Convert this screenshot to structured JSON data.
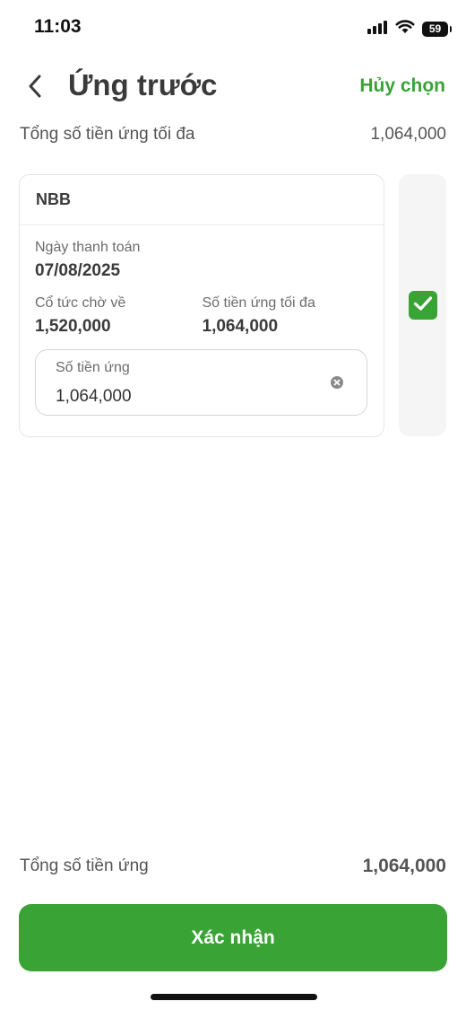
{
  "status_bar": {
    "time": "11:03",
    "battery": "59"
  },
  "header": {
    "title": "Ứng trước",
    "cancel_label": "Hủy chọn"
  },
  "summary": {
    "max_total_label": "Tổng số tiền ứng tối đa",
    "max_total_value": "1,064,000"
  },
  "card": {
    "symbol": "NBB",
    "payment_date_label": "Ngày thanh toán",
    "payment_date_value": "07/08/2025",
    "dividend_label": "Cổ tức chờ về",
    "dividend_value": "1,520,000",
    "max_advance_label": "Số tiền ứng tối đa",
    "max_advance_value": "1,064,000",
    "amount_input": {
      "label": "Số tiền ứng",
      "value": "1,064,000"
    },
    "selected": true
  },
  "footer": {
    "total_label": "Tổng số tiền ứng",
    "total_value": "1,064,000",
    "confirm_label": "Xác nhận"
  },
  "colors": {
    "accent": "#3aa335",
    "text": "#3a3a3a",
    "muted": "#6b6b6b"
  },
  "icons": {
    "back": "chevron-left-icon",
    "clear": "clear-circle-icon",
    "check": "check-icon",
    "signal": "signal-icon",
    "wifi": "wifi-icon",
    "battery": "battery-icon"
  }
}
